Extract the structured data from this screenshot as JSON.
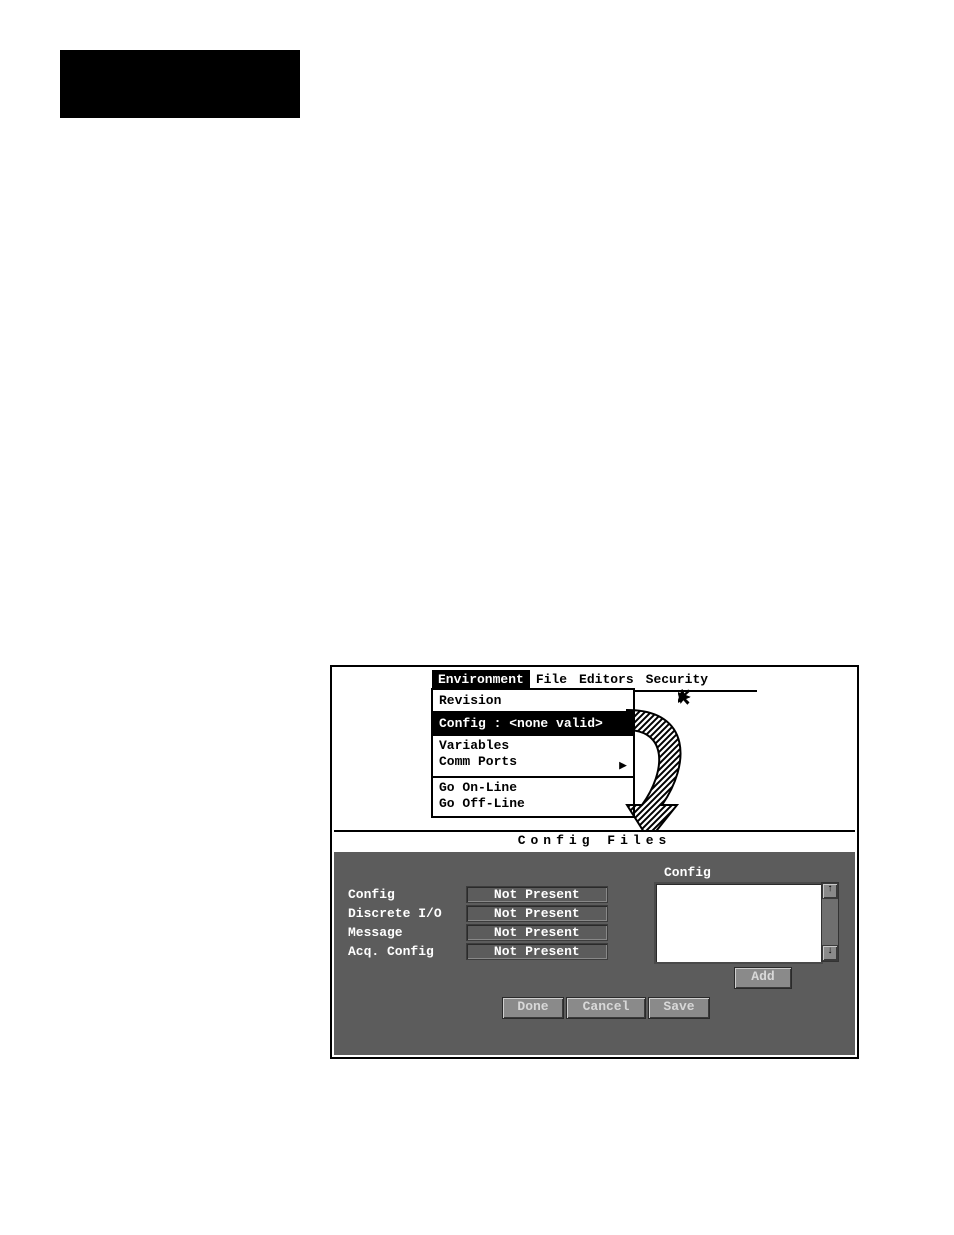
{
  "menubar": {
    "environment": "Environment",
    "file": "File",
    "editors": "Editors",
    "security": "Security"
  },
  "dropdown": {
    "revision": "Revision",
    "config": "Config : <none valid>",
    "variables": "Variables",
    "comm_ports": "Comm Ports",
    "go_online": "Go On-Line",
    "go_offline": "Go Off-Line"
  },
  "panel": {
    "title": "Config Files",
    "config_header": "Config",
    "rows": [
      {
        "label": "Config",
        "value": "Not Present"
      },
      {
        "label": "Discrete I/O",
        "value": "Not Present"
      },
      {
        "label": "Message",
        "value": "Not Present"
      },
      {
        "label": "Acq. Config",
        "value": "Not Present"
      }
    ],
    "buttons": {
      "add": "Add",
      "done": "Done",
      "cancel": "Cancel",
      "save": "Save"
    },
    "scroll_up": "↑",
    "scroll_down": "↓"
  },
  "submenu_arrow": "▶"
}
